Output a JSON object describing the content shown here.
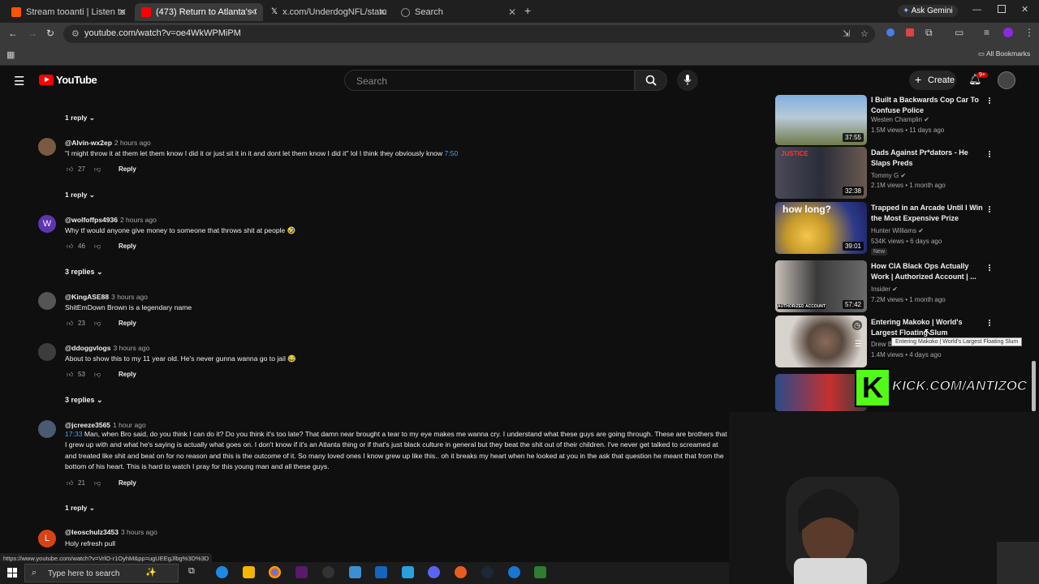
{
  "browser": {
    "tabs": [
      {
        "title": "Stream tooanti | Listen to mf pl"
      },
      {
        "title": "(473) Return to Atlanta's Crazie"
      },
      {
        "title": "x.com/UnderdogNFL/status/20"
      },
      {
        "title": "Search"
      }
    ],
    "ask_gemini": "Ask Gemini",
    "url": "youtube.com/watch?v=oe4WkWPMiPM",
    "all_bookmarks": "All Bookmarks"
  },
  "youtube": {
    "logo_text": "YouTube",
    "search_placeholder": "Search",
    "create_label": "Create",
    "notif_badge": "9+"
  },
  "comments": {
    "top_reply": "1 reply",
    "items": [
      {
        "handle": "@Alvin-wx2ep",
        "ago": "2 hours ago",
        "text": "\"I might throw it at them let them know I did it or just sit it in it and dont let them know I did it\" lol I think they obviously know ",
        "timestamp": "7:50",
        "likes": "27",
        "reply": "Reply",
        "replies": "1 reply"
      },
      {
        "handle": "@wolfoffps4936",
        "ago": "2 hours ago",
        "text": "Why tf would anyone give money to someone that throws shit at people 🤣",
        "likes": "46",
        "reply": "Reply",
        "replies": "3 replies",
        "avatar_letter": "W"
      },
      {
        "handle": "@KingASE88",
        "ago": "3 hours ago",
        "text": "ShitEmDown Brown is a legendary name",
        "likes": "23",
        "reply": "Reply"
      },
      {
        "handle": "@ddoggvlogs",
        "ago": "3 hours ago",
        "text": "About to show this to my 11 year old. He's never gunna wanna go to jail 😂",
        "likes": "53",
        "reply": "Reply",
        "replies": "3 replies"
      },
      {
        "handle": "@jcreeze3565",
        "ago": "1 hour ago",
        "timestamp": "17:33",
        "text": " Man, when Bro said, do you think I can do it? Do you think it's too late? That damn near brought a tear to my eye makes me wanna cry. I understand what these guys are going through. These are brothers that I grew up with and what he's saying is actually what goes on. I don't know if it's an Atlanta thing or if that's just black culture in general but they beat the shit out of their children. I've never get talked to screamed at and treated like shit and beat on for no reason and this is the outcome of it. So many loved ones I know grew up like this.. oh it breaks my heart when he looked at you in the ask that question he meant that from the bottom of his heart. This is hard to watch I pray for this young man and all these guys.",
        "likes": "21",
        "reply": "Reply",
        "replies": "1 reply"
      },
      {
        "handle": "@leoschulz3453",
        "ago": "3 hours ago",
        "text": "Holy refresh pull",
        "avatar_letter": "L"
      }
    ]
  },
  "sidebar": {
    "videos": [
      {
        "title": "I Built a Backwards Cop Car To Confuse Police",
        "channel": "Westen Champlin",
        "meta": "1.5M views • 11 days ago",
        "duration": "37:55"
      },
      {
        "title": "Dads Against Pr*dators - He Slaps Preds",
        "channel": "Tommy G",
        "meta": "2.1M views • 1 month ago",
        "duration": "32:38",
        "thumb_text": "JUSTICE"
      },
      {
        "title": "Trapped in an Arcade Until I Win the Most Expensive Prize",
        "channel": "Hunter Williams",
        "meta": "534K views • 6 days ago",
        "duration": "39:01",
        "badge": "New",
        "thumb_text": "how long?"
      },
      {
        "title": "How CIA Black Ops Actually Work | Authorized Account | ...",
        "channel": "Insider",
        "meta": "7.2M views • 1 month ago",
        "duration": "57:42",
        "thumb_text": "AUTHORIZED ACCOUNT"
      },
      {
        "title": "Entering Makoko | World's Largest Floating Slum",
        "channel": "Drew B",
        "meta": "1.4M views • 4 days ago"
      }
    ],
    "tooltip": "Entering Makoko | World's Largest Floating Slum"
  },
  "overlay": {
    "kick_text": "KICK.COM/ANTIZOC"
  },
  "status_url": "https://www.youtube.com/watch?v=VrlO-r1OyhM&pp=ugUEEgJlbg%3D%3D",
  "taskbar": {
    "search_placeholder": "Type here to search"
  },
  "colors": {
    "bg": "#0f0f0f",
    "link": "#3ea6ff",
    "yt_red": "#ff0000",
    "kick_green": "#53fc18"
  }
}
